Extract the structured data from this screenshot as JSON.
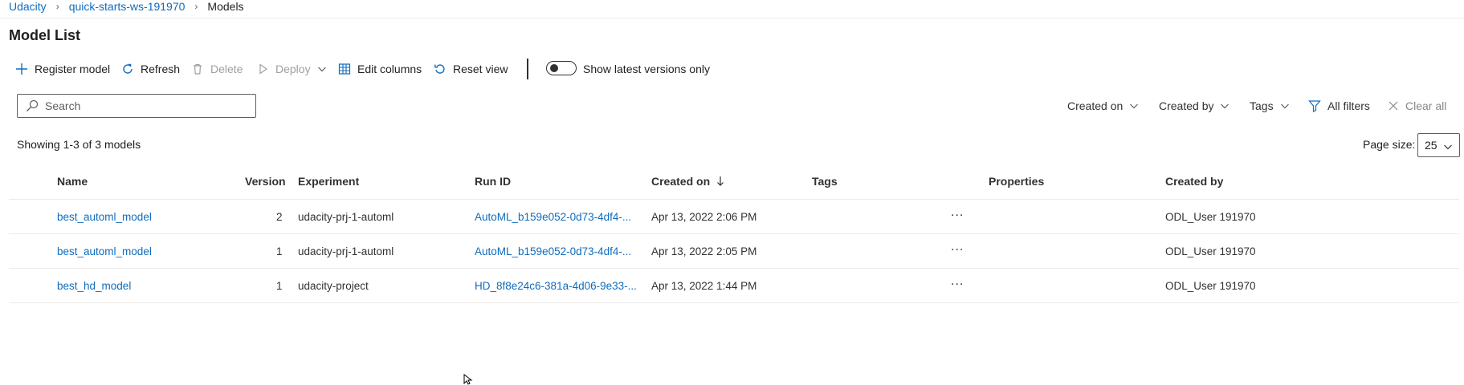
{
  "breadcrumb": {
    "items": [
      "Udacity",
      "quick-starts-ws-191970",
      "Models"
    ]
  },
  "page": {
    "title": "Model List"
  },
  "toolbar": {
    "register": "Register model",
    "refresh": "Refresh",
    "delete": "Delete",
    "deploy": "Deploy",
    "edit_columns": "Edit columns",
    "reset_view": "Reset view",
    "toggle_label": "Show latest versions only"
  },
  "search": {
    "placeholder": "Search"
  },
  "filters": {
    "created_on": "Created on",
    "created_by": "Created by",
    "tags": "Tags",
    "all_filters": "All filters",
    "clear_all": "Clear all"
  },
  "list": {
    "showing": "Showing 1-3 of 3 models",
    "page_size_label": "Page size:",
    "page_size_value": "25"
  },
  "table": {
    "columns": [
      "Name",
      "Version",
      "Experiment",
      "Run ID",
      "Created on",
      "Tags",
      "Properties",
      "Created by"
    ],
    "rows": [
      {
        "name": "best_automl_model",
        "version": "2",
        "experiment": "udacity-prj-1-automl",
        "run_id": "AutoML_b159e052-0d73-4df4-...",
        "created_on": "Apr 13, 2022 2:06 PM",
        "tags": "",
        "properties": "...",
        "created_by": "ODL_User 191970"
      },
      {
        "name": "best_automl_model",
        "version": "1",
        "experiment": "udacity-prj-1-automl",
        "run_id": "AutoML_b159e052-0d73-4df4-...",
        "created_on": "Apr 13, 2022 2:05 PM",
        "tags": "",
        "properties": "...",
        "created_by": "ODL_User 191970"
      },
      {
        "name": "best_hd_model",
        "version": "1",
        "experiment": "udacity-project",
        "run_id": "HD_8f8e24c6-381a-4d06-9e33-...",
        "created_on": "Apr 13, 2022 1:44 PM",
        "tags": "",
        "properties": "...",
        "created_by": "ODL_User 191970"
      }
    ]
  },
  "colors": {
    "accent": "#0f6cbd",
    "text": "#323130",
    "disabled": "#a19f9d",
    "divider": "#edebe9"
  }
}
